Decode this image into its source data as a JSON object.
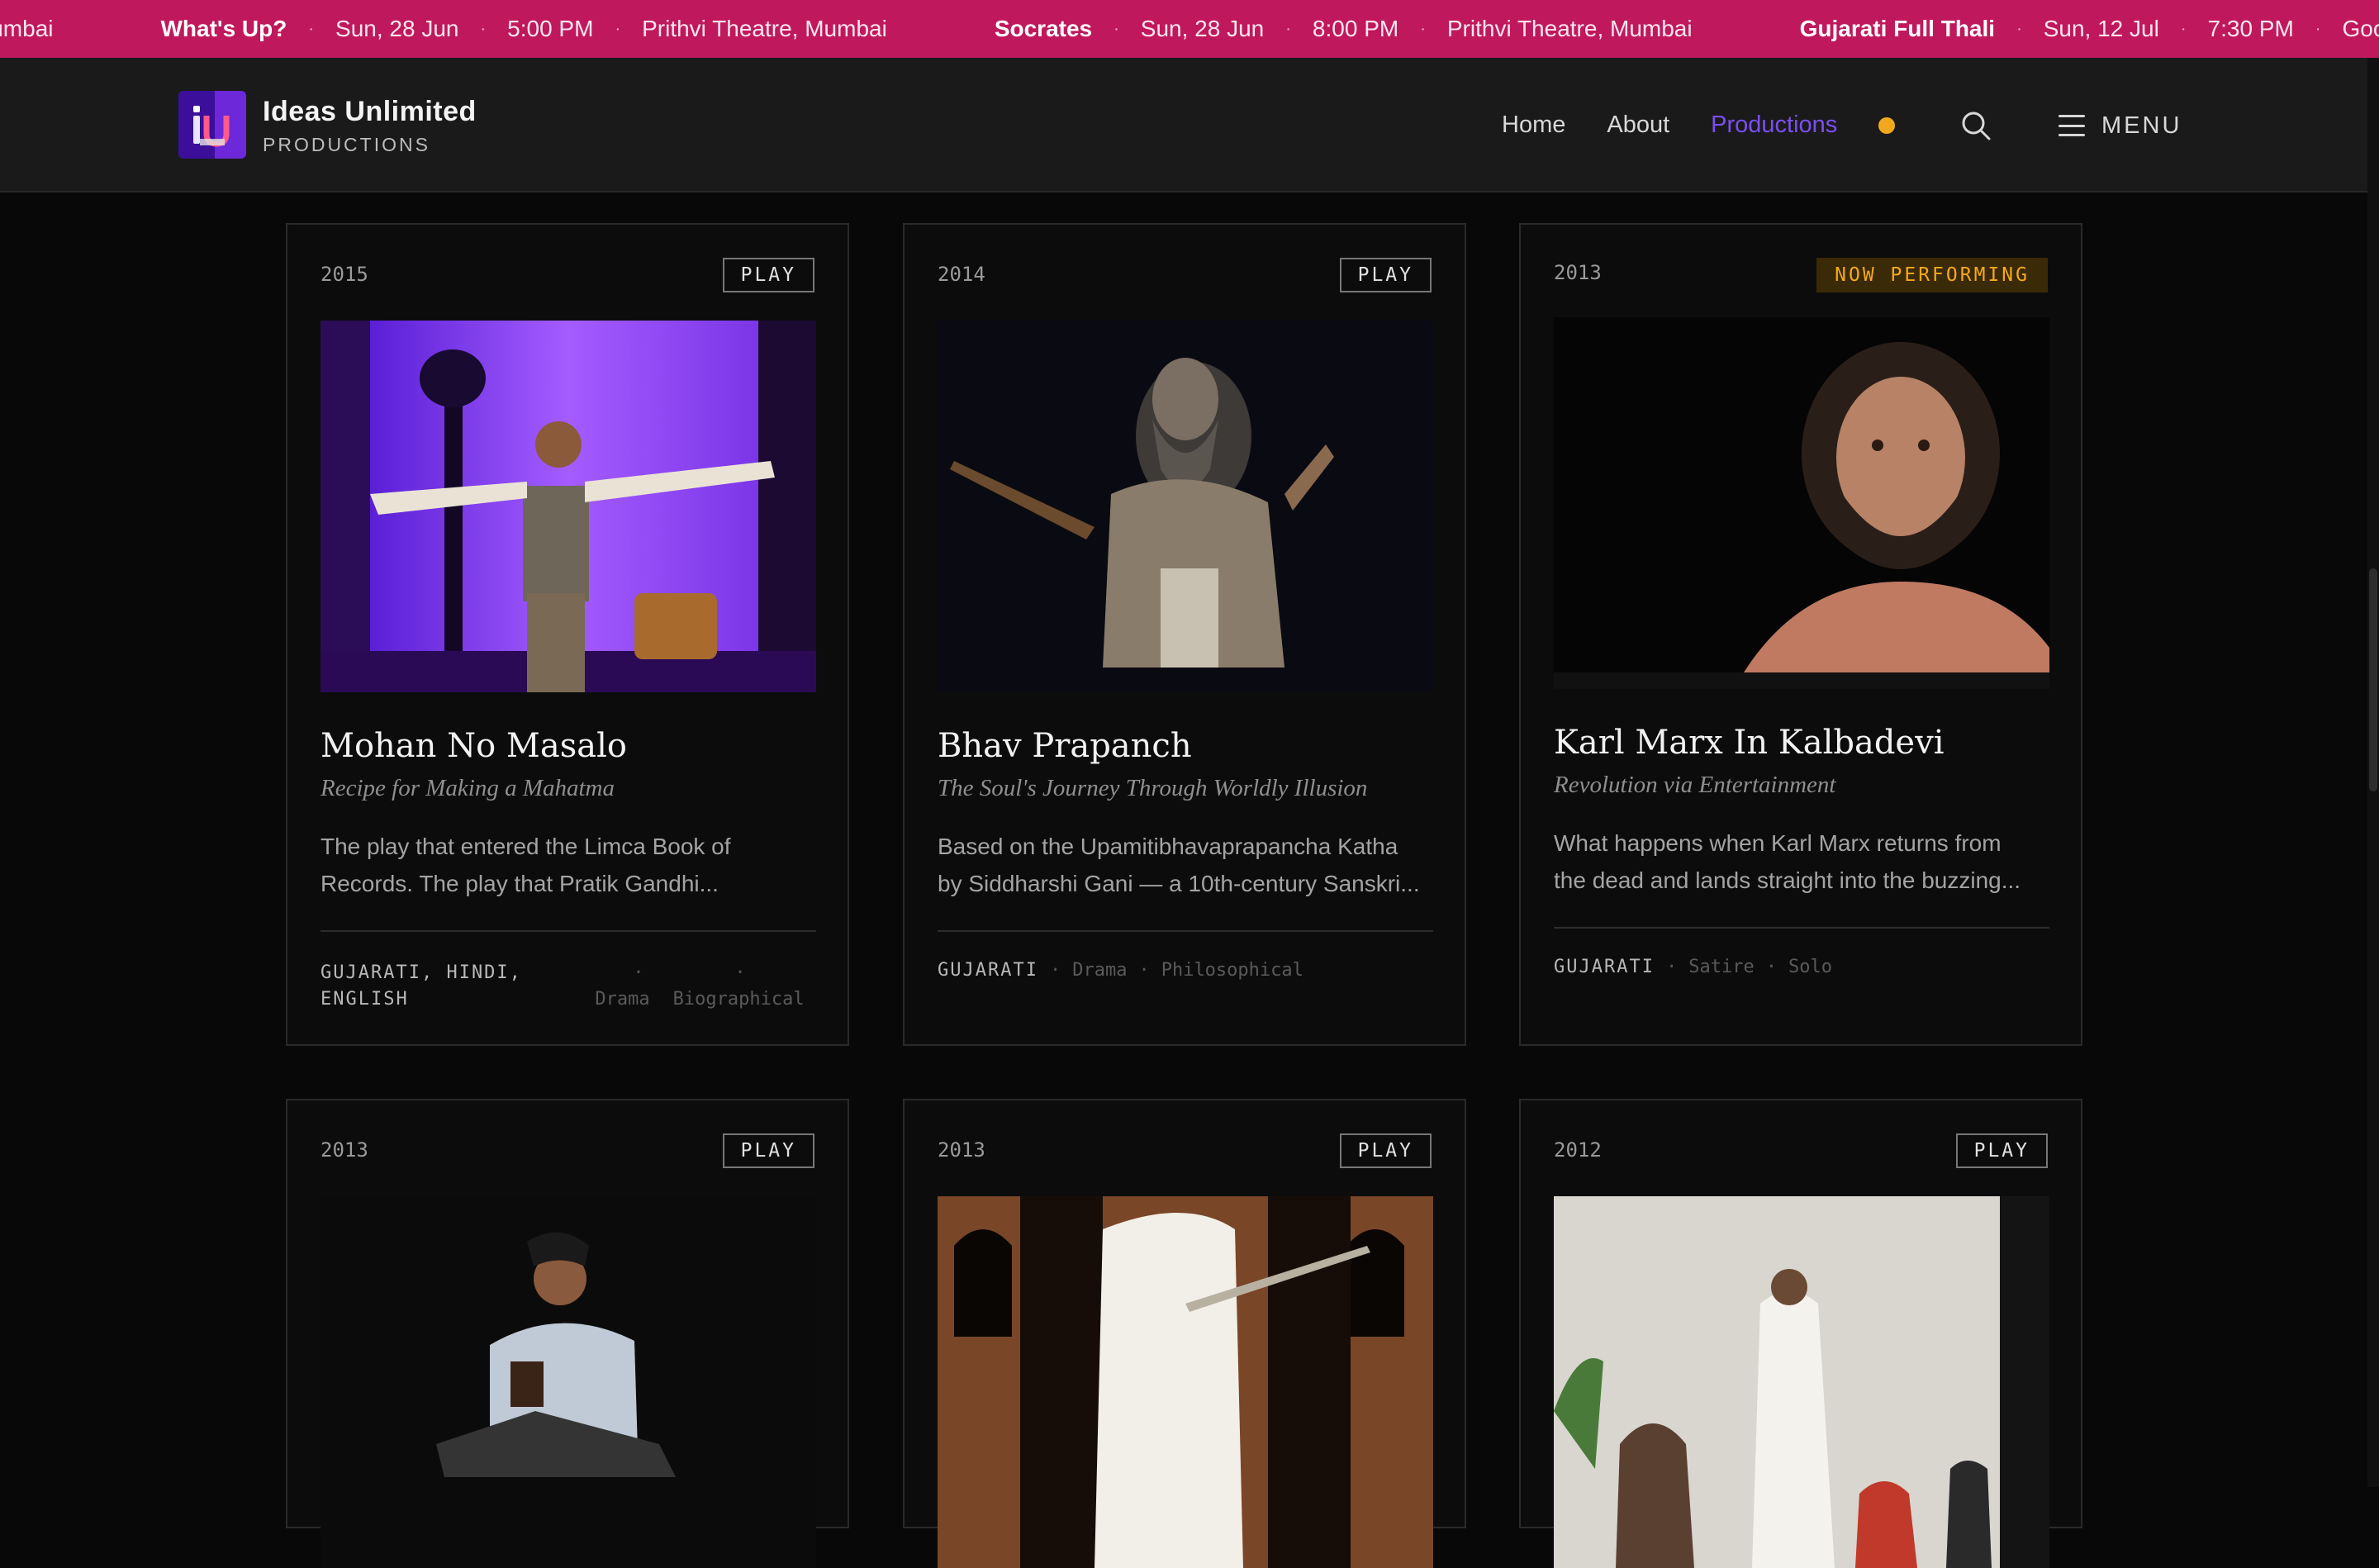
{
  "ticker": {
    "items": [
      {
        "title": "",
        "date": "",
        "time": "",
        "venue": "lumbai"
      },
      {
        "title": "What's Up?",
        "date": "Sun, 28 Jun",
        "time": "5:00 PM",
        "venue": "Prithvi Theatre, Mumbai"
      },
      {
        "title": "Socrates",
        "date": "Sun, 28 Jun",
        "time": "8:00 PM",
        "venue": "Prithvi Theatre, Mumbai"
      },
      {
        "title": "Gujarati Full Thali",
        "date": "Sun, 12 Jul",
        "time": "7:30 PM",
        "venue": "Goo"
      }
    ]
  },
  "brand": {
    "name": "Ideas Unlimited",
    "sub": "PRODUCTIONS"
  },
  "nav": {
    "home": "Home",
    "about": "About",
    "productions": "Productions",
    "menu": "MENU"
  },
  "colors": {
    "ticker_bg": "#c0185c",
    "accent": "#7b4ff0",
    "dot": "#f2a81d",
    "now_badge": "#f4a91b"
  },
  "cards": [
    {
      "year": "2015",
      "badge": "PLAY",
      "title": "Mohan No Masalo",
      "subtitle": "Recipe for Making a Mahatma",
      "desc1": "The play that entered the Limca Book of",
      "desc2": "Records. The play that Pratik Gandhi...",
      "lang1": "GUJARATI, HINDI,",
      "lang2": "ENGLISH",
      "tag1": "Drama",
      "tag2": "Biographical"
    },
    {
      "year": "2014",
      "badge": "PLAY",
      "title": "Bhav Prapanch",
      "subtitle": "The Soul's Journey Through Worldly Illusion",
      "desc1": "Based on the Upamitibhavaprapancha Katha",
      "desc2": "by Siddharshi Gani — a 10th-century Sanskri...",
      "lang": "GUJARATI",
      "tag1": "Drama",
      "tag2": "Philosophical"
    },
    {
      "year": "2013",
      "badge": "NOW PERFORMING",
      "title": "Karl Marx In Kalbadevi",
      "subtitle": "Revolution via Entertainment",
      "desc1": "What happens when Karl Marx returns from",
      "desc2": "the dead and lands straight into the buzzing...",
      "lang": "GUJARATI",
      "tag1": "Satire",
      "tag2": "Solo"
    },
    {
      "year": "2013",
      "badge": "PLAY"
    },
    {
      "year": "2013",
      "badge": "PLAY"
    },
    {
      "year": "2012",
      "badge": "PLAY"
    }
  ]
}
